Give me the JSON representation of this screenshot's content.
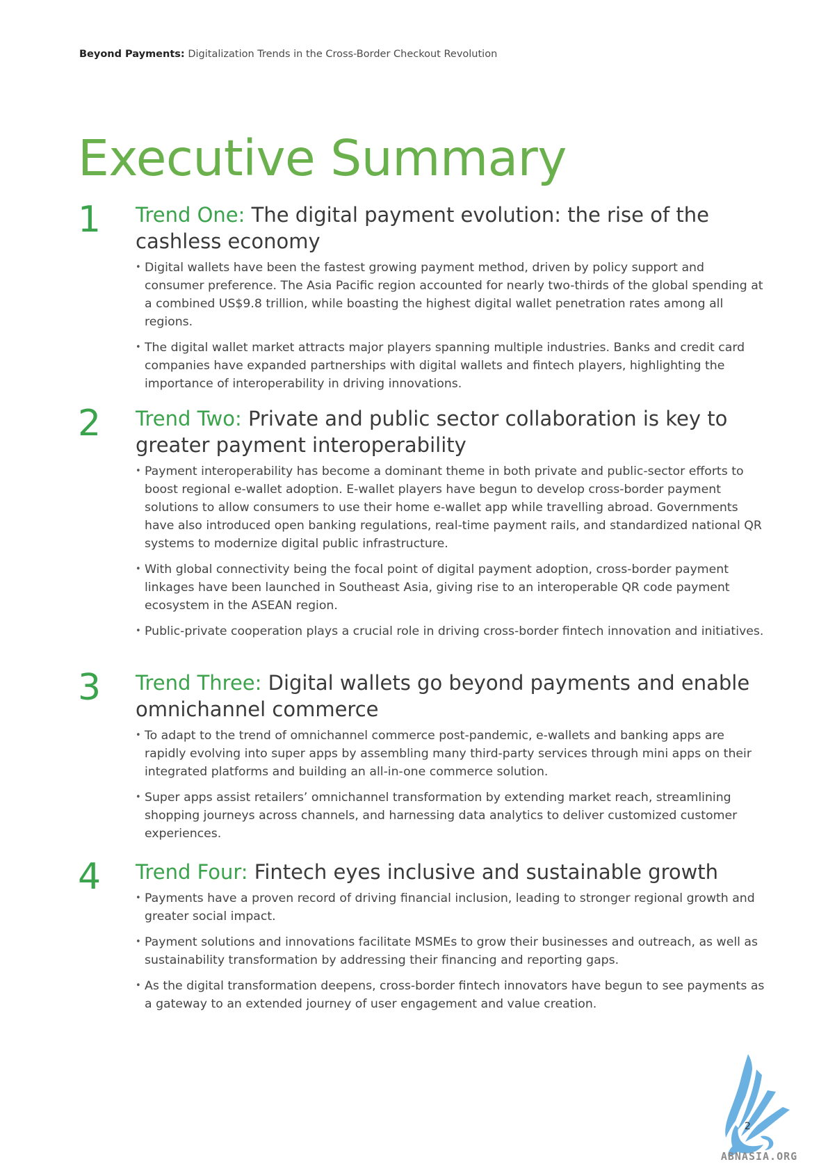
{
  "header": {
    "bold": "Beyond Payments:",
    "rest": " Digitalization Trends in the Cross-Border Checkout Revolution"
  },
  "title": "Executive Summary",
  "trends": [
    {
      "number": "1",
      "lead": "Trend One:",
      "heading": " The digital payment evolution: the rise of the cashless economy",
      "bullets": [
        "Digital wallets have been the fastest growing payment method, driven by policy support and consumer preference. The Asia Pacific region accounted for nearly two-thirds of the global spending at a combined US$9.8 trillion, while boasting the highest digital wallet penetration rates among all regions.",
        "The digital wallet market attracts major players spanning multiple industries. Banks and credit card companies have expanded partnerships with digital wallets and fintech players, highlighting the importance of interoperability in driving innovations."
      ]
    },
    {
      "number": "2",
      "lead": "Trend Two:",
      "heading": " Private and public sector collaboration is key to greater payment interoperability",
      "bullets": [
        "Payment interoperability has become a dominant theme in both private and public-sector efforts to boost regional e-wallet adoption. E-wallet players have begun to develop cross-border payment solutions to allow consumers to use their home e-wallet app while travelling abroad. Governments have also introduced open banking regulations, real-time payment rails, and standardized national QR systems to modernize digital public infrastructure.",
        "With global connectivity being the focal point of digital payment adoption, cross-border payment linkages have been launched in Southeast Asia, giving rise to an interoperable QR code payment ecosystem in the ASEAN region.",
        "Public-private cooperation plays a crucial role in driving cross-border fintech innovation and initiatives."
      ]
    },
    {
      "number": "3",
      "lead": "Trend Three:",
      "heading": " Digital wallets go beyond payments and enable omnichannel commerce",
      "bullets": [
        "To adapt to the trend of omnichannel commerce post-pandemic, e-wallets and banking apps are rapidly evolving into super apps by assembling many third-party services through mini apps on their integrated platforms and building an all-in-one commerce solution.",
        "Super apps assist retailers’ omnichannel transformation by extending market reach, streamlining shopping journeys across channels, and harnessing data analytics to deliver customized customer experiences."
      ]
    },
    {
      "number": "4",
      "lead": "Trend Four:",
      "heading": " Fintech eyes inclusive and sustainable growth",
      "bullets": [
        "Payments have a proven record of driving financial inclusion, leading to stronger regional growth and greater social impact.",
        "Payment solutions and innovations facilitate MSMEs to grow their businesses and outreach, as well as sustainability transformation by addressing their financing and reporting gaps.",
        "As the digital transformation deepens, cross-border fintech innovators have begun to see payments as a gateway to an extended journey of user engagement and value creation."
      ]
    }
  ],
  "page_number": "2",
  "watermark": {
    "text": "ABNASIA.ORG",
    "icon": "dragon-logo-icon",
    "color": "#5aa9df"
  },
  "colors": {
    "title_green": "#6ab04c",
    "accent_green": "#3aa34b",
    "body_text": "#444444"
  }
}
